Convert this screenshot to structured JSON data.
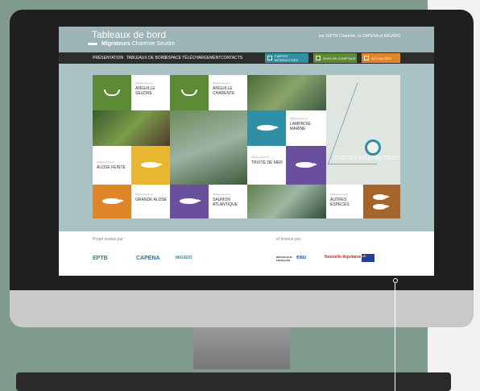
{
  "header": {
    "title": "Tableaux de bord",
    "subtitle_bold": "Migrateurs",
    "subtitle_rest": "Charente Seudre",
    "partners": "par l'EPTB Charente, la CAPENA et MIGADO"
  },
  "nav": {
    "items": [
      "PRÉSENTATION",
      "TABLEAUX DE BORD",
      "ESPACE TÉLÉCHARGEMENT",
      "CONTACTS"
    ],
    "cartes": "CARTES INTERACTIVES",
    "suivi": "SUIVI DE COMPTAGE",
    "actualites": "ACTUALITÉS"
  },
  "tiles": {
    "small_caption": "Tableau de bord",
    "anguille_seudre": "ANGUILLE SEUDRE",
    "anguille_charente": "ANGUILLE CHARENTE",
    "lamproie": "LAMPROIE MARINE",
    "alose_feinte": "ALOSE FEINTE",
    "truite": "TRUITE DE MER",
    "grande_alose": "GRANDE ALOSE",
    "saumon": "SAUMON ATLANTIQUE",
    "autres": "AUTRES ESPÈCES",
    "cartes": "CARTES INTERACTIVES"
  },
  "footer": {
    "porte": "Projet réalisé par :",
    "finance": "et financé par :",
    "logos_left": [
      "EPTB",
      "CAPENA",
      "MIGADO"
    ],
    "logos_right": [
      "RÉPUBLIQUE FRANÇAISE",
      "eau",
      "Nouvelle-Aquitaine",
      "UE"
    ]
  },
  "colors": {
    "green": "#5c8a35",
    "teal": "#2f8fa4",
    "yellow": "#e8b630",
    "orange": "#e0862a",
    "purple": "#6a4f9c",
    "brown": "#a5652a"
  }
}
